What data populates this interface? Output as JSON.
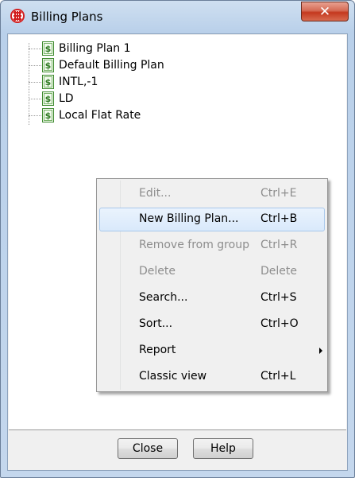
{
  "window": {
    "title": "Billing Plans",
    "close_glyph": "✕"
  },
  "tree": {
    "items": [
      {
        "label": "Billing Plan 1",
        "icon": "billing-plan-icon"
      },
      {
        "label": "Default Billing Plan",
        "icon": "billing-plan-icon"
      },
      {
        "label": "INTL,-1",
        "icon": "billing-plan-icon"
      },
      {
        "label": "LD",
        "icon": "billing-plan-icon"
      },
      {
        "label": "Local Flat Rate",
        "icon": "billing-plan-icon"
      }
    ]
  },
  "context_menu": {
    "items": [
      {
        "label": "Edit...",
        "shortcut": "Ctrl+E",
        "enabled": false
      },
      {
        "label": "New Billing Plan...",
        "shortcut": "Ctrl+B",
        "enabled": true,
        "highlighted": true
      },
      {
        "label": "Remove from group",
        "shortcut": "Ctrl+R",
        "enabled": false
      },
      {
        "label": "Delete",
        "shortcut": "Delete",
        "enabled": false
      },
      {
        "label": "Search...",
        "shortcut": "Ctrl+S",
        "enabled": true
      },
      {
        "label": "Sort...",
        "shortcut": "Ctrl+O",
        "enabled": true
      },
      {
        "label": "Report",
        "shortcut": "",
        "enabled": true,
        "submenu": true
      },
      {
        "label": "Classic view",
        "shortcut": "Ctrl+L",
        "enabled": true
      }
    ]
  },
  "buttons": {
    "close": "Close",
    "help": "Help"
  }
}
